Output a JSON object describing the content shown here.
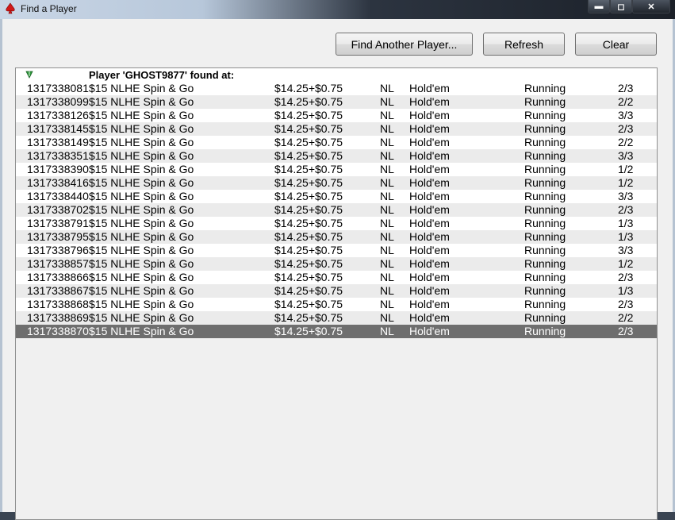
{
  "window": {
    "title": "Find a Player",
    "icon": "pokerstars-spade-icon",
    "controls": {
      "minimize": "▬",
      "maximize": "◻",
      "close": "✕"
    }
  },
  "toolbar": {
    "find_label": "Find Another Player...",
    "refresh_label": "Refresh",
    "clear_label": "Clear"
  },
  "results": {
    "header": "Player 'GHOST9877' found at:",
    "sort_icon": "green-triangle-down-icon",
    "selected_color": "#6e6e6e",
    "rows": [
      {
        "id": "1317338081",
        "name": "$15 NLHE Spin & Go",
        "buyin": "$14.25+$0.75",
        "limit": "NL",
        "game": "Hold'em",
        "status": "Running",
        "players": "2/3"
      },
      {
        "id": "1317338099",
        "name": "$15 NLHE Spin & Go",
        "buyin": "$14.25+$0.75",
        "limit": "NL",
        "game": "Hold'em",
        "status": "Running",
        "players": "2/2"
      },
      {
        "id": "1317338126",
        "name": "$15 NLHE Spin & Go",
        "buyin": "$14.25+$0.75",
        "limit": "NL",
        "game": "Hold'em",
        "status": "Running",
        "players": "3/3"
      },
      {
        "id": "1317338145",
        "name": "$15 NLHE Spin & Go",
        "buyin": "$14.25+$0.75",
        "limit": "NL",
        "game": "Hold'em",
        "status": "Running",
        "players": "2/3"
      },
      {
        "id": "1317338149",
        "name": "$15 NLHE Spin & Go",
        "buyin": "$14.25+$0.75",
        "limit": "NL",
        "game": "Hold'em",
        "status": "Running",
        "players": "2/2"
      },
      {
        "id": "1317338351",
        "name": "$15 NLHE Spin & Go",
        "buyin": "$14.25+$0.75",
        "limit": "NL",
        "game": "Hold'em",
        "status": "Running",
        "players": "3/3"
      },
      {
        "id": "1317338390",
        "name": "$15 NLHE Spin & Go",
        "buyin": "$14.25+$0.75",
        "limit": "NL",
        "game": "Hold'em",
        "status": "Running",
        "players": "1/2"
      },
      {
        "id": "1317338416",
        "name": "$15 NLHE Spin & Go",
        "buyin": "$14.25+$0.75",
        "limit": "NL",
        "game": "Hold'em",
        "status": "Running",
        "players": "1/2"
      },
      {
        "id": "1317338440",
        "name": "$15 NLHE Spin & Go",
        "buyin": "$14.25+$0.75",
        "limit": "NL",
        "game": "Hold'em",
        "status": "Running",
        "players": "3/3"
      },
      {
        "id": "1317338702",
        "name": "$15 NLHE Spin & Go",
        "buyin": "$14.25+$0.75",
        "limit": "NL",
        "game": "Hold'em",
        "status": "Running",
        "players": "2/3"
      },
      {
        "id": "1317338791",
        "name": "$15 NLHE Spin & Go",
        "buyin": "$14.25+$0.75",
        "limit": "NL",
        "game": "Hold'em",
        "status": "Running",
        "players": "1/3"
      },
      {
        "id": "1317338795",
        "name": "$15 NLHE Spin & Go",
        "buyin": "$14.25+$0.75",
        "limit": "NL",
        "game": "Hold'em",
        "status": "Running",
        "players": "1/3"
      },
      {
        "id": "1317338796",
        "name": "$15 NLHE Spin & Go",
        "buyin": "$14.25+$0.75",
        "limit": "NL",
        "game": "Hold'em",
        "status": "Running",
        "players": "3/3"
      },
      {
        "id": "1317338857",
        "name": "$15 NLHE Spin & Go",
        "buyin": "$14.25+$0.75",
        "limit": "NL",
        "game": "Hold'em",
        "status": "Running",
        "players": "1/2"
      },
      {
        "id": "1317338866",
        "name": "$15 NLHE Spin & Go",
        "buyin": "$14.25+$0.75",
        "limit": "NL",
        "game": "Hold'em",
        "status": "Running",
        "players": "2/3"
      },
      {
        "id": "1317338867",
        "name": "$15 NLHE Spin & Go",
        "buyin": "$14.25+$0.75",
        "limit": "NL",
        "game": "Hold'em",
        "status": "Running",
        "players": "1/3"
      },
      {
        "id": "1317338868",
        "name": "$15 NLHE Spin & Go",
        "buyin": "$14.25+$0.75",
        "limit": "NL",
        "game": "Hold'em",
        "status": "Running",
        "players": "2/3"
      },
      {
        "id": "1317338869",
        "name": "$15 NLHE Spin & Go",
        "buyin": "$14.25+$0.75",
        "limit": "NL",
        "game": "Hold'em",
        "status": "Running",
        "players": "2/2"
      },
      {
        "id": "1317338870",
        "name": "$15 NLHE Spin & Go",
        "buyin": "$14.25+$0.75",
        "limit": "NL",
        "game": "Hold'em",
        "status": "Running",
        "players": "2/3",
        "selected": true
      }
    ]
  }
}
